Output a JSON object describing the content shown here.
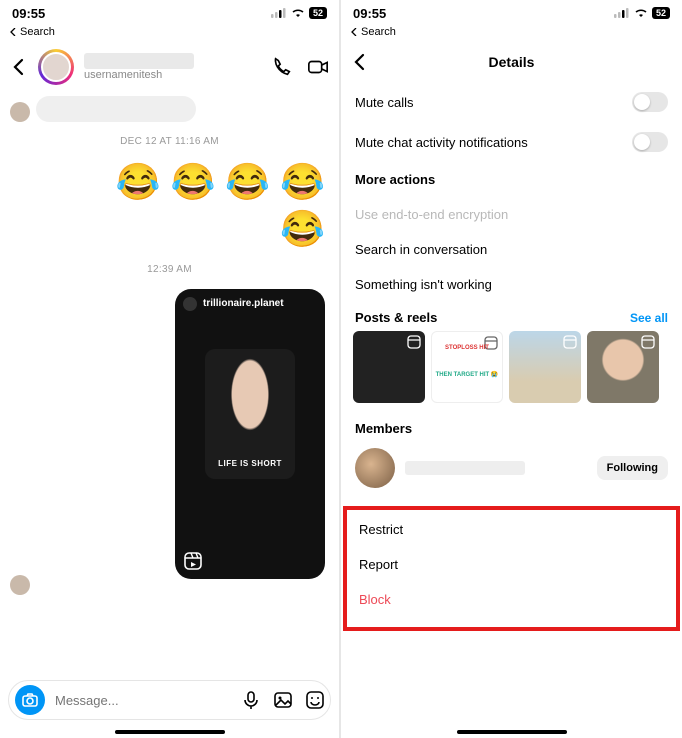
{
  "status": {
    "time": "09:55",
    "back_search": "Search",
    "battery": "52"
  },
  "left": {
    "header": {
      "username": "usernamenitesh"
    },
    "ts1": "DEC 12 AT 11:16 AM",
    "emoji_line1": "😂 😂 😂 😂",
    "emoji_line2": "😂",
    "ts2": "12:39 AM",
    "media": {
      "account": "trillionaire.planet",
      "caption": "LIFE IS SHORT"
    },
    "composer_placeholder": "Message..."
  },
  "right": {
    "title": "Details",
    "rows": {
      "mute_calls": "Mute calls",
      "mute_chat": "Mute chat activity notifications",
      "more_actions": "More actions",
      "e2ee": "Use end-to-end encryption",
      "search": "Search in conversation",
      "not_working": "Something isn't working"
    },
    "posts_reels": {
      "title": "Posts & reels",
      "see_all": "See all",
      "tile2_top": "STOPLOSS HIT",
      "tile2_bot": "THEN TARGET HIT 😭"
    },
    "members": {
      "title": "Members",
      "follow": "Following"
    },
    "actions": {
      "restrict": "Restrict",
      "report": "Report",
      "block": "Block"
    }
  }
}
